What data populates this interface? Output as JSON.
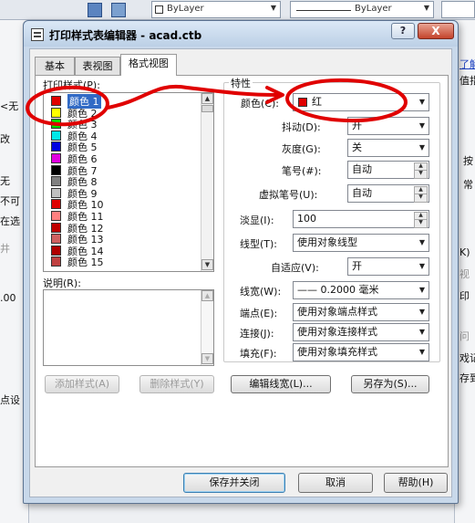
{
  "background": {
    "linetype_label": "ByLayer",
    "lineweight_label": "ByLayer",
    "left_fragments": [
      "<无",
      "改",
      "无",
      "不可",
      "在选",
      "井",
      ".00",
      "点设"
    ],
    "right_fragments": [
      "了解",
      "值指",
      "按",
      "常",
      "K)",
      "视",
      "印",
      "问",
      "戏记",
      "存到"
    ]
  },
  "dialog": {
    "title": "打印样式表编辑器 - acad.ctb",
    "help_glyph": "?",
    "close_glyph": "X",
    "tabs": [
      "基本",
      "表视图",
      "格式视图"
    ],
    "print_styles_label": "打印样式(P):",
    "styles": [
      {
        "name": "颜色 1",
        "color": "#e00000"
      },
      {
        "name": "颜色 2",
        "color": "#ffff00"
      },
      {
        "name": "颜色 3",
        "color": "#00e000"
      },
      {
        "name": "颜色 4",
        "color": "#00e8e8"
      },
      {
        "name": "颜色 5",
        "color": "#0000e0"
      },
      {
        "name": "颜色 6",
        "color": "#e000e0"
      },
      {
        "name": "颜色 7",
        "color": "#000000"
      },
      {
        "name": "颜色 8",
        "color": "#808080"
      },
      {
        "name": "颜色 9",
        "color": "#c0c0c0"
      },
      {
        "name": "颜色 10",
        "color": "#e00000"
      },
      {
        "name": "颜色 11",
        "color": "#ff8080"
      },
      {
        "name": "颜色 12",
        "color": "#c00000"
      },
      {
        "name": "颜色 13",
        "color": "#d06060"
      },
      {
        "name": "颜色 14",
        "color": "#b00000"
      },
      {
        "name": "颜色 15",
        "color": "#c04040"
      }
    ],
    "description_label": "说明(R):",
    "add_style_btn": "添加样式(A)",
    "delete_style_btn": "删除样式(Y)",
    "properties_label": "特性",
    "color_label": "颜色(C):",
    "color_value": "红",
    "color_swatch": "#e00000",
    "dither_label": "抖动(D):",
    "dither_value": "开",
    "grayscale_label": "灰度(G):",
    "grayscale_value": "关",
    "pen_label": "笔号(#):",
    "pen_value": "自动",
    "virtual_pen_label": "虚拟笔号(U):",
    "virtual_pen_value": "自动",
    "screening_label": "淡显(I):",
    "screening_value": "100",
    "linetype_label": "线型(T):",
    "linetype_value": "使用对象线型",
    "adaptive_label": "自适应(V):",
    "adaptive_value": "开",
    "lineweight_label": "线宽(W):",
    "lineweight_value": "—— 0.2000 毫米",
    "endstyle_label": "端点(E):",
    "endstyle_value": "使用对象端点样式",
    "joinstyle_label": "连接(J):",
    "joinstyle_value": "使用对象连接样式",
    "fill_label": "填充(F):",
    "fill_value": "使用对象填充样式",
    "edit_lineweights_btn": "编辑线宽(L)...",
    "save_as_btn": "另存为(S)...",
    "save_close_btn": "保存并关闭",
    "cancel_btn": "取消",
    "help_btn": "帮助(H)"
  },
  "annotation_color": "#e00000"
}
